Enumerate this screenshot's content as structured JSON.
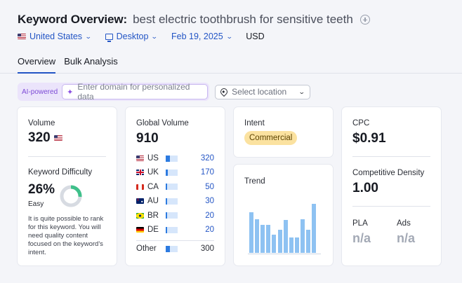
{
  "header": {
    "title_prefix": "Keyword Overview:",
    "keyword": "best electric toothbrush for sensitive teeth"
  },
  "filters": {
    "country": "United States",
    "device": "Desktop",
    "date": "Feb 19, 2025",
    "currency": "USD"
  },
  "tabs": [
    {
      "label": "Overview",
      "active": true
    },
    {
      "label": "Bulk Analysis",
      "active": false
    }
  ],
  "ai": {
    "label": "AI-powered",
    "placeholder": "Enter domain for personalized data"
  },
  "location": {
    "placeholder": "Select location"
  },
  "volume": {
    "label": "Volume",
    "value": "320"
  },
  "kd": {
    "label": "Keyword Difficulty",
    "value": "26%",
    "level": "Easy",
    "percent": 26,
    "description": "It is quite possible to rank for this keyword. You will need quality content focused on the keyword's intent."
  },
  "global_volume": {
    "label": "Global Volume",
    "value": "910",
    "rows": [
      {
        "code": "US",
        "value": "320",
        "fraction": 0.35
      },
      {
        "code": "UK",
        "value": "170",
        "fraction": 0.19
      },
      {
        "code": "CA",
        "value": "50",
        "fraction": 0.06
      },
      {
        "code": "AU",
        "value": "30",
        "fraction": 0.04
      },
      {
        "code": "BR",
        "value": "20",
        "fraction": 0.03
      },
      {
        "code": "DE",
        "value": "20",
        "fraction": 0.03
      }
    ],
    "other": {
      "label": "Other",
      "value": "300",
      "fraction": 0.33
    }
  },
  "intent": {
    "label": "Intent",
    "value": "Commercial"
  },
  "trend": {
    "label": "Trend",
    "values": [
      1.0,
      0.83,
      0.69,
      0.69,
      0.44,
      0.56,
      0.81,
      0.37,
      0.37,
      0.83,
      0.56,
      1.2
    ]
  },
  "cpc": {
    "label": "CPC",
    "value": "$0.91"
  },
  "competitive_density": {
    "label": "Competitive Density",
    "value": "1.00"
  },
  "pla": {
    "label": "PLA",
    "value": "n/a"
  },
  "ads": {
    "label": "Ads",
    "value": "n/a"
  }
}
